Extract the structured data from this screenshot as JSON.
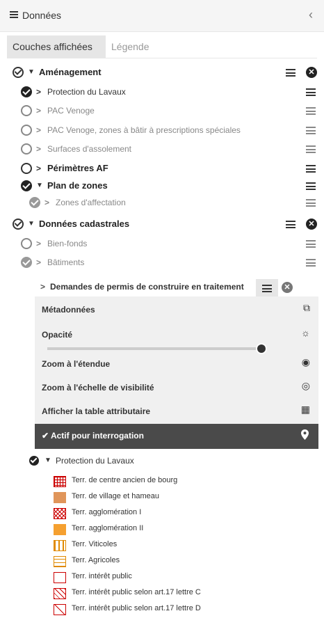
{
  "header": {
    "title": "Données",
    "collapse_icon": "chevron-left-icon"
  },
  "tabs": {
    "active": "Couches affichées",
    "inactive": "Légende"
  },
  "layers": [
    {
      "label": "Aménagement",
      "indent": 0,
      "check": "outline",
      "caret": "open",
      "style": "b",
      "menu": "dark",
      "x": true
    },
    {
      "label": "Protection du Lavaux",
      "indent": 1,
      "check": "full",
      "caret": "closed",
      "style": "d",
      "menu": "dark",
      "x": false
    },
    {
      "label": "PAC Venoge",
      "indent": 1,
      "check": "empty-gray",
      "caret": "closed-gray",
      "style": "g",
      "menu": "gray",
      "x": false
    },
    {
      "label": "PAC Venoge, zones à bâtir à prescriptions spéciales",
      "indent": 1,
      "check": "empty-gray",
      "caret": "closed-gray",
      "style": "g",
      "menu": "gray",
      "x": false
    },
    {
      "label": "Surfaces d'assolement",
      "indent": 1,
      "check": "empty-gray",
      "caret": "closed-gray",
      "style": "g",
      "menu": "gray",
      "x": false
    },
    {
      "label": "Périmètres AF",
      "indent": 1,
      "check": "empty",
      "caret": "closed",
      "style": "b",
      "menu": "dark",
      "x": false
    },
    {
      "label": "Plan de zones",
      "indent": 1,
      "check": "full",
      "caret": "open",
      "style": "b",
      "menu": "dark",
      "x": false
    },
    {
      "label": "Zones d'affectation",
      "indent": 2,
      "check": "full-gray",
      "caret": "closed-gray",
      "style": "g",
      "menu": "gray",
      "x": false
    },
    {
      "label": "Données cadastrales",
      "indent": 0,
      "check": "outline",
      "caret": "open",
      "style": "b",
      "menu": "dark",
      "x": true
    },
    {
      "label": "Bien-fonds",
      "indent": 1,
      "check": "empty-gray",
      "caret": "closed-gray",
      "style": "g",
      "menu": "gray",
      "x": false
    },
    {
      "label": "Bâtiments",
      "indent": 1,
      "check": "full-gray",
      "caret": "closed-gray",
      "style": "g",
      "menu": "gray",
      "x": false
    }
  ],
  "panel": {
    "title": "Demandes de permis de construire en traitement",
    "items": {
      "metadata": "Métadonnées",
      "opacity": "Opacité",
      "zoom_extent": "Zoom à l'étendue",
      "zoom_scale": "Zoom à l'échelle de visibilité",
      "attribute_table": "Afficher la table attributaire",
      "active_query": "✔ Actif pour interrogation"
    },
    "opacity_value": 1.0
  },
  "legend": {
    "group_label": "Protection du Lavaux",
    "items": [
      {
        "label": "Terr. de centre ancien de bourg",
        "pattern": "grid-red"
      },
      {
        "label": "Terr. de village et hameau",
        "pattern": "fill-brown"
      },
      {
        "label": "Terr. agglomération I",
        "pattern": "crosshatch-red"
      },
      {
        "label": "Terr. agglomération II",
        "pattern": "fill-orange"
      },
      {
        "label": "Terr. Viticoles",
        "pattern": "vstripe-orange"
      },
      {
        "label": "Terr. Agricoles",
        "pattern": "hstripe-orange"
      },
      {
        "label": "Terr. intérêt public",
        "pattern": "empty-red"
      },
      {
        "label": "Terr. intérêt public selon art.17 lettre C",
        "pattern": "diag-red"
      },
      {
        "label": "Terr. intérêt public selon art.17 lettre D",
        "pattern": "diag-single-red"
      }
    ]
  }
}
